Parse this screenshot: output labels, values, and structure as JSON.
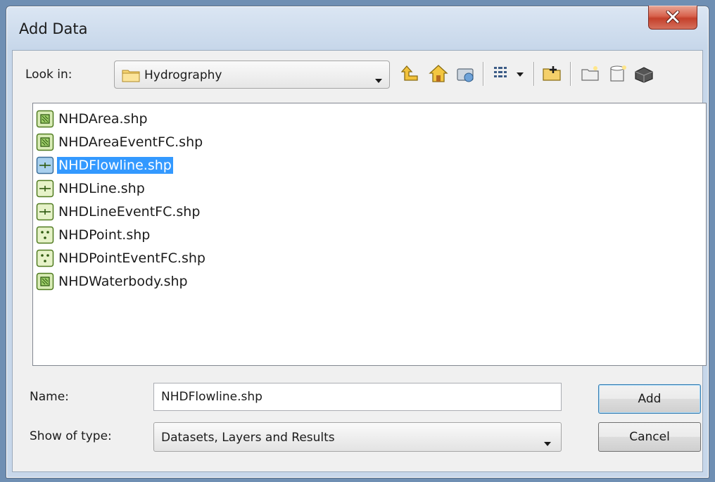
{
  "window": {
    "title": "Add Data"
  },
  "look_in": {
    "label": "Look in:",
    "value": "Hydrography"
  },
  "toolbar": {
    "icons": [
      "up-one-level-icon",
      "go-home-icon",
      "catalog-connections-icon",
      "view-list-icon",
      "view-dropdown-icon",
      "connect-folder-icon",
      "new-folder-icon",
      "new-file-geodatabase-icon",
      "new-personal-geodatabase-icon"
    ]
  },
  "files": [
    {
      "name": "NHDArea.shp",
      "icon": "polygon-shapefile-icon"
    },
    {
      "name": "NHDAreaEventFC.shp",
      "icon": "polygon-shapefile-icon"
    },
    {
      "name": "NHDFlowline.shp",
      "icon": "line-shapefile-icon",
      "selected": true
    },
    {
      "name": "NHDLine.shp",
      "icon": "line-shapefile-icon"
    },
    {
      "name": "NHDLineEventFC.shp",
      "icon": "line-shapefile-icon"
    },
    {
      "name": "NHDPoint.shp",
      "icon": "point-shapefile-icon"
    },
    {
      "name": "NHDPointEventFC.shp",
      "icon": "point-shapefile-icon"
    },
    {
      "name": "NHDWaterbody.shp",
      "icon": "polygon-shapefile-icon"
    }
  ],
  "name_field": {
    "label": "Name:",
    "value": "NHDFlowline.shp"
  },
  "type_field": {
    "label": "Show of type:",
    "value": "Datasets, Layers and Results"
  },
  "buttons": {
    "add": "Add",
    "cancel": "Cancel"
  },
  "colors": {
    "selection": "#3399ff",
    "window_frame": "#c7d7ea",
    "close_button": "#c4402b"
  }
}
